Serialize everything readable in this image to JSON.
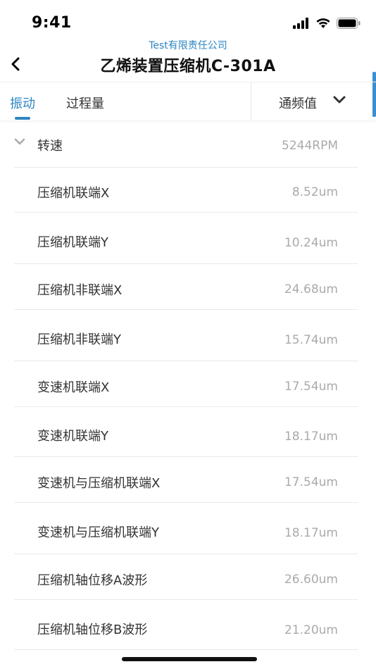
{
  "status_bar": {
    "time": "9:41"
  },
  "header": {
    "company": "Test有限责任公司",
    "title": "乙烯装置压缩机C-301A"
  },
  "tabs": [
    {
      "label": "振动",
      "active": true
    },
    {
      "label": "过程量",
      "active": false
    }
  ],
  "filter": {
    "selected": "通频值"
  },
  "speed": {
    "label": "转速",
    "value": "5244RPM"
  },
  "items": [
    {
      "label": "压缩机联端X",
      "value": "8.52um"
    },
    {
      "label": "压缩机联端Y",
      "value": "10.24um"
    },
    {
      "label": "压缩机非联端X",
      "value": "24.68um"
    },
    {
      "label": "压缩机非联端Y",
      "value": "15.74um"
    },
    {
      "label": "变速机联端X",
      "value": "17.54um"
    },
    {
      "label": "变速机联端Y",
      "value": "18.17um"
    },
    {
      "label": "变速机与压缩机联端X",
      "value": "17.54um"
    },
    {
      "label": "变速机与压缩机联端Y",
      "value": "18.17um"
    },
    {
      "label": "压缩机轴位移A波形",
      "value": "26.60um"
    },
    {
      "label": "压缩机轴位移B波形",
      "value": "21.20um"
    }
  ],
  "colors": {
    "accent": "#2e86c1",
    "value_text": "#aaaaaa",
    "divider": "#e9e9e9"
  }
}
